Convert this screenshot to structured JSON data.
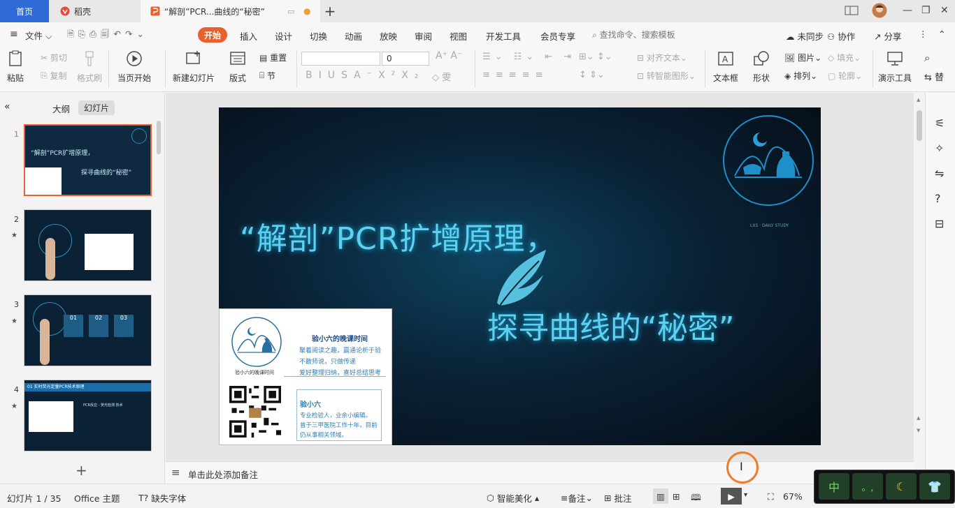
{
  "tabs": {
    "home": "首页",
    "daoke": "稻壳",
    "document": "“解剖”PCR...曲线的“秘密”"
  },
  "menu": {
    "file": "文件",
    "start": "开始",
    "items": [
      "插入",
      "设计",
      "切换",
      "动画",
      "放映",
      "审阅",
      "视图",
      "开发工具",
      "会员专享"
    ],
    "search": "查找命令、搜索模板",
    "sync": "未同步",
    "collab": "协作",
    "share": "分享"
  },
  "ribbon": {
    "paste": "粘贴",
    "cut": "剪切",
    "copy": "复制",
    "format_brush": "格式刷",
    "from_current": "当页开始",
    "new_slide": "新建幻灯片",
    "layout": "版式",
    "reset": "重置",
    "section": "节",
    "font_size": "0",
    "align_text": "对齐文本",
    "smart_shape": "转智能图形",
    "textbox": "文本框",
    "shape": "形状",
    "picture": "图片",
    "arrange": "排列",
    "fill": "填充",
    "outline": "轮廓",
    "present_tools": "演示工具"
  },
  "left_panel": {
    "outline_tab": "大纲",
    "slides_tab": "幻灯片",
    "thumbs": [
      {
        "num": "1",
        "line1": "“解剖”PCR扩增原理，",
        "line2": "探寻曲线的“秘密”"
      },
      {
        "num": "2"
      },
      {
        "num": "3",
        "boxes": [
          "01",
          "02",
          "03"
        ]
      },
      {
        "num": "4",
        "header": "01  实时荧光定量PCR技术原理",
        "subtitle": "PCR反应 - 荧光检测 技术"
      }
    ]
  },
  "slide": {
    "title_line1": "“解剖”PCR扩增原理，",
    "title_line2": "探寻曲线的“秘密”",
    "tiny_text": "LXS · DAILY STUDY",
    "card": {
      "title": "验小六的晚课时间",
      "lines": [
        "聚着阅读之趣，赢通论析于验",
        "不敢师说，只做传递",
        "爱好整理归纳，喜好总结思考"
      ],
      "logo_caption": "验小六的晚课时间",
      "name": "验小六",
      "bio": [
        "专业检验人，业余小编辑。",
        "曾于三甲医院工作十年，目前",
        "仍从事相关领域。"
      ]
    }
  },
  "notes_placeholder": "单击此处添加备注",
  "status": {
    "slide_info": "幻灯片 1 / 35",
    "theme": "Office 主题",
    "missing_font": "缺失字体",
    "beautify": "智能美化",
    "notes": "备注",
    "comments": "批注",
    "zoom": "67%"
  },
  "ime": {
    "mode": "中",
    "punct": "。,"
  },
  "colors": {
    "accent": "#e8602c",
    "home_tab": "#2f6bd6",
    "slide_text": "#5fd0ee"
  }
}
